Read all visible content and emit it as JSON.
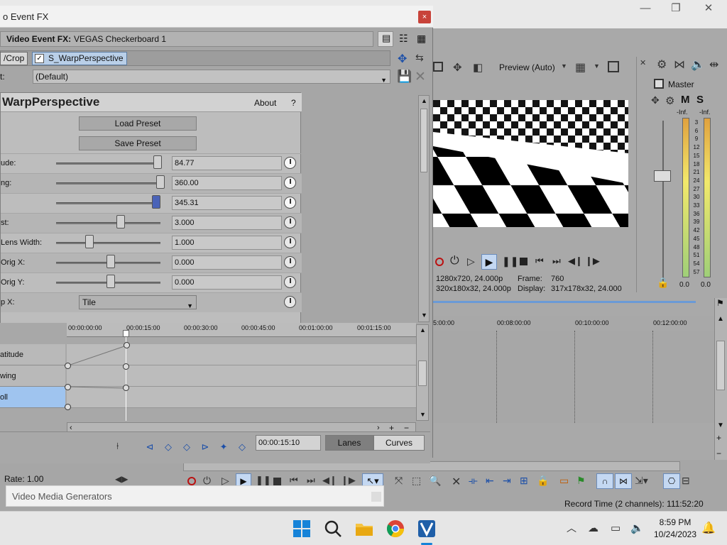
{
  "dialog": {
    "title": "o Event FX",
    "close_glyph": "×",
    "label_prefix": "Video Event FX:",
    "event_name": "VEGAS Checkerboard 1",
    "chain": {
      "crop_label": "/Crop",
      "active_label": "S_WarpPerspective"
    },
    "preset_prefix": "t:",
    "preset_value": "(Default)"
  },
  "plugin": {
    "title": "WarpPerspective",
    "about": "About",
    "help": "?",
    "load_preset": "Load Preset",
    "save_preset": "Save Preset",
    "params": [
      {
        "label": "ude:",
        "value": "84.77",
        "fill": 0.97
      },
      {
        "label": "ng:",
        "value": "360.00",
        "fill": 1.0
      },
      {
        "label": "",
        "value": "345.31",
        "fill": 0.96
      },
      {
        "label": "st:",
        "value": "3.000",
        "fill": 0.6
      },
      {
        "label": " Lens Width:",
        "value": "1.000",
        "fill": 0.29
      },
      {
        "label": " Orig X:",
        "value": "0.000",
        "fill": 0.5
      },
      {
        "label": " Orig Y:",
        "value": "0.000",
        "fill": 0.5
      },
      {
        "label": "p X:",
        "value": "Tile",
        "type": "select"
      }
    ]
  },
  "keyframes": {
    "ruler_ticks": [
      "00:00:00:00",
      "00:00:15:00",
      "00:00:30:00",
      "00:00:45:00",
      "00:01:00:00",
      "00:01:15:00"
    ],
    "tracks": [
      "atitude",
      "wing",
      "oll"
    ],
    "time": "00:00:15:10",
    "lanes_label": "Lanes",
    "curves_label": "Curves"
  },
  "preview": {
    "mode": "Preview (Auto)",
    "project_res": "1280x720, 24.000p",
    "preview_res": "320x180x32, 24.000p",
    "frame_label": "Frame:",
    "frame_value": "760",
    "display_label": "Display:",
    "display_value": "317x178x32, 24.000"
  },
  "master": {
    "label": "Master",
    "m": "M",
    "s": "S",
    "left_inf": "-Inf.",
    "right_inf": "-Inf.",
    "scale": [
      "3",
      "6",
      "9",
      "12",
      "15",
      "18",
      "21",
      "24",
      "27",
      "30",
      "33",
      "36",
      "39",
      "42",
      "45",
      "48",
      "51",
      "54",
      "57"
    ],
    "left_out": "0.0",
    "right_out": "0.0"
  },
  "timeline": {
    "ticks": [
      "5:00:00",
      "00:08:00:00",
      "00:10:00:00",
      "00:12:00:00"
    ]
  },
  "bottom": {
    "rate": "Rate: 1.00",
    "record_time": "Record Time (2 channels): 111:52:20",
    "video_media_generators": "Video Media Generators"
  },
  "taskbar": {
    "time": "8:59 PM",
    "date": "10/24/2023"
  },
  "colors": {
    "accent": "#1c4fa8",
    "selection": "#9fc4ef",
    "close": "#c8433a"
  }
}
